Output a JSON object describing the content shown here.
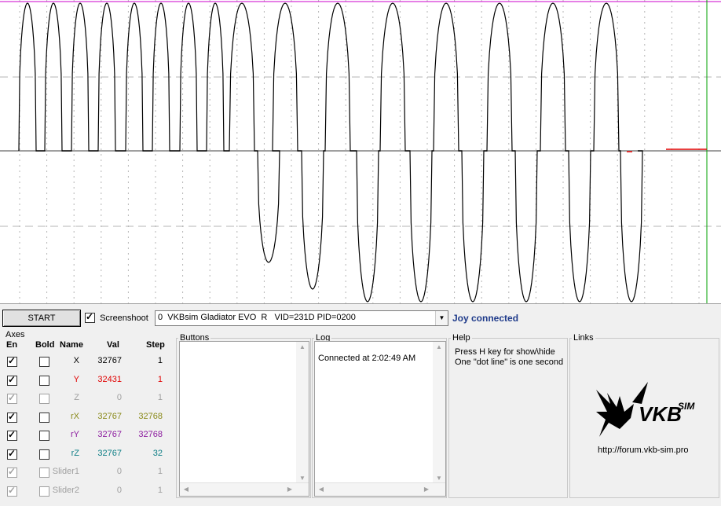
{
  "controls": {
    "start_label": "START",
    "screenshot_label": "Screenshoot",
    "screenshot_checked": true,
    "device_select": "0  VKBsim Gladiator EVO  R   VID=231D PID=0200",
    "status": "Joy connected"
  },
  "axes": {
    "title": "Axes",
    "headers": {
      "en": "En",
      "bold": "Bold",
      "name": "Name",
      "val": "Val",
      "step": "Step"
    },
    "rows": [
      {
        "en": true,
        "bold": false,
        "name": "X",
        "val": "32767",
        "step": "1",
        "color": "#000000",
        "disabled": false
      },
      {
        "en": true,
        "bold": false,
        "name": "Y",
        "val": "32431",
        "step": "1",
        "color": "#e00000",
        "disabled": false
      },
      {
        "en": true,
        "bold": false,
        "name": "Z",
        "val": "0",
        "step": "1",
        "color": "#a0a0a0",
        "disabled": true
      },
      {
        "en": true,
        "bold": false,
        "name": "rX",
        "val": "32767",
        "step": "32768",
        "color": "#8a8a1a",
        "disabled": false
      },
      {
        "en": true,
        "bold": false,
        "name": "rY",
        "val": "32767",
        "step": "32768",
        "color": "#8b1a9e",
        "disabled": false
      },
      {
        "en": true,
        "bold": false,
        "name": "rZ",
        "val": "32767",
        "step": "32",
        "color": "#0f7f86",
        "disabled": false
      },
      {
        "en": true,
        "bold": false,
        "name": "Slider1",
        "val": "0",
        "step": "1",
        "color": "#a0a0a0",
        "disabled": true
      },
      {
        "en": true,
        "bold": false,
        "name": "Slider2",
        "val": "0",
        "step": "1",
        "color": "#a0a0a0",
        "disabled": true
      }
    ]
  },
  "buttons_panel": {
    "title": "Buttons"
  },
  "log": {
    "title": "Log",
    "lines": [
      "Connected at 2:02:49 AM"
    ]
  },
  "help": {
    "title": "Help",
    "line1": "Press H key for show\\hide",
    "line2": "One \"dot line\" is one second"
  },
  "links": {
    "title": "Links",
    "logo_text": "VKB",
    "logo_sup": "SIM",
    "url": "http://forum.vkb-sim.pro"
  },
  "plot": {
    "colors": {
      "trace": "#000000",
      "top_line": "#cc00cc",
      "mid_line": "#a0a0a0",
      "grid": "#b4b4b4",
      "cursor": "#00a000",
      "marker": "#e00000"
    }
  }
}
